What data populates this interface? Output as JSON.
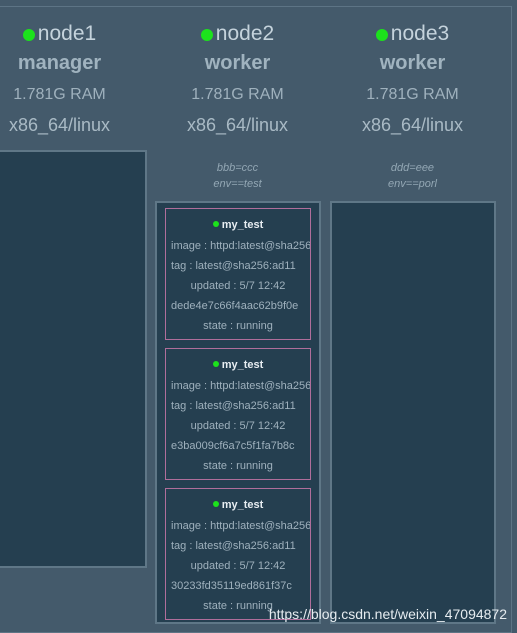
{
  "nodes": [
    {
      "name": "node1",
      "role": "manager",
      "ram": "1.781G RAM",
      "arch": "x86_64/linux",
      "status_color": "#1ce21c",
      "labels": []
    },
    {
      "name": "node2",
      "role": "worker",
      "ram": "1.781G RAM",
      "arch": "x86_64/linux",
      "status_color": "#1ce21c",
      "labels": [
        "bbb=ccc",
        "env==test"
      ]
    },
    {
      "name": "node3",
      "role": "worker",
      "ram": "1.781G RAM",
      "arch": "x86_64/linux",
      "status_color": "#1ce21c",
      "labels": [
        "ddd=eee",
        "env==porl"
      ]
    }
  ],
  "tasks": [
    {
      "name": "my_test",
      "image": "image : httpd:latest@sha256:",
      "tag": "tag : latest@sha256:ad11",
      "updated": "updated : 5/7 12:42",
      "id": "dede4e7c66f4aac62b9f0e",
      "state": "state : running"
    },
    {
      "name": "my_test",
      "image": "image : httpd:latest@sha256:",
      "tag": "tag : latest@sha256:ad11",
      "updated": "updated : 5/7 12:42",
      "id": "e3ba009cf6a7c5f1fa7b8c",
      "state": "state : running"
    },
    {
      "name": "my_test",
      "image": "image : httpd:latest@sha256:",
      "tag": "tag : latest@sha256:ad11",
      "updated": "updated : 5/7 12:42",
      "id": "30233fd35119ed861f37c",
      "state": "state : running"
    }
  ],
  "watermark": "https://blog.csdn.net/weixin_47094872",
  "colors": {
    "background": "#445a6b",
    "column": "#253f50",
    "task_border": "#b06e9b",
    "status_running": "#1ce21c"
  }
}
